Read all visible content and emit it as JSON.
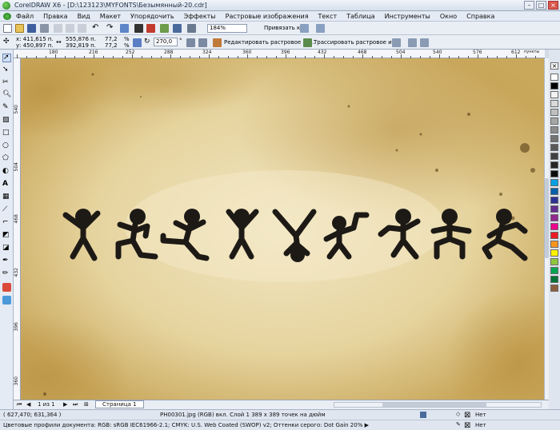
{
  "window": {
    "title": "CorelDRAW X6 - [D:\\123123\\MYFONTS\\Безымянный-20.cdr]"
  },
  "menu": [
    "Файл",
    "Правка",
    "Вид",
    "Макет",
    "Упорядочить",
    "Эффекты",
    "Растровые изображения",
    "Текст",
    "Таблица",
    "Инструменты",
    "Окно",
    "Справка"
  ],
  "toolbar": {
    "zoom": "184%",
    "snap_label": "Привязать к"
  },
  "propertybar": {
    "x": "х: 411,615 п.",
    "y": "у: 450,897 п.",
    "w": "555,876 п.",
    "h": "392,819 п.",
    "scale_x": "77,2",
    "scale_y": "77,2",
    "pct1": "%",
    "pct2": "%",
    "angle": "270,0",
    "angle_unit": "°",
    "edit_bitmap": "Редактировать растровое из...",
    "trace_bitmap": "Трассировать растровое из..."
  },
  "ruler_h": [
    "180",
    "216",
    "252",
    "288",
    "324",
    "360",
    "396",
    "432",
    "468",
    "504",
    "540",
    "576",
    "612"
  ],
  "ruler_h_unit": "пункты",
  "ruler_v": [
    "540",
    "504",
    "468",
    "432",
    "396",
    "360"
  ],
  "pagenav": {
    "count": "1 из 1",
    "tab": "Страница 1"
  },
  "status": {
    "coords": "( 627,470; 631,364 )",
    "info": "PH00301.jpg (RGB) вкл. Слой 1 389 x 389 точек на дюйм",
    "fill_none": "Нет",
    "outline_none": "Нет",
    "profiles": "Цветовые профили документа: RGB: sRGB IEC61966-2.1; CMYK: U.S. Web Coated (SWOP) v2; Оттенки серого: Dot Gain 20% ▶"
  },
  "colors": {
    "palette": [
      "#ffffff",
      "#000000",
      "#f2f2f2",
      "#d9d9d9",
      "#bfbfbf",
      "#a6a6a6",
      "#8c8c8c",
      "#737373",
      "#595959",
      "#404040",
      "#262626",
      "#0d0d0d",
      "#00a0e3",
      "#0060a8",
      "#2e3192",
      "#662d91",
      "#92278f",
      "#ec008c",
      "#ed1c24",
      "#f7941d",
      "#fff200",
      "#8dc63f",
      "#00a651",
      "#007236",
      "#8b5e3c"
    ],
    "figure": "#1d1a16"
  }
}
